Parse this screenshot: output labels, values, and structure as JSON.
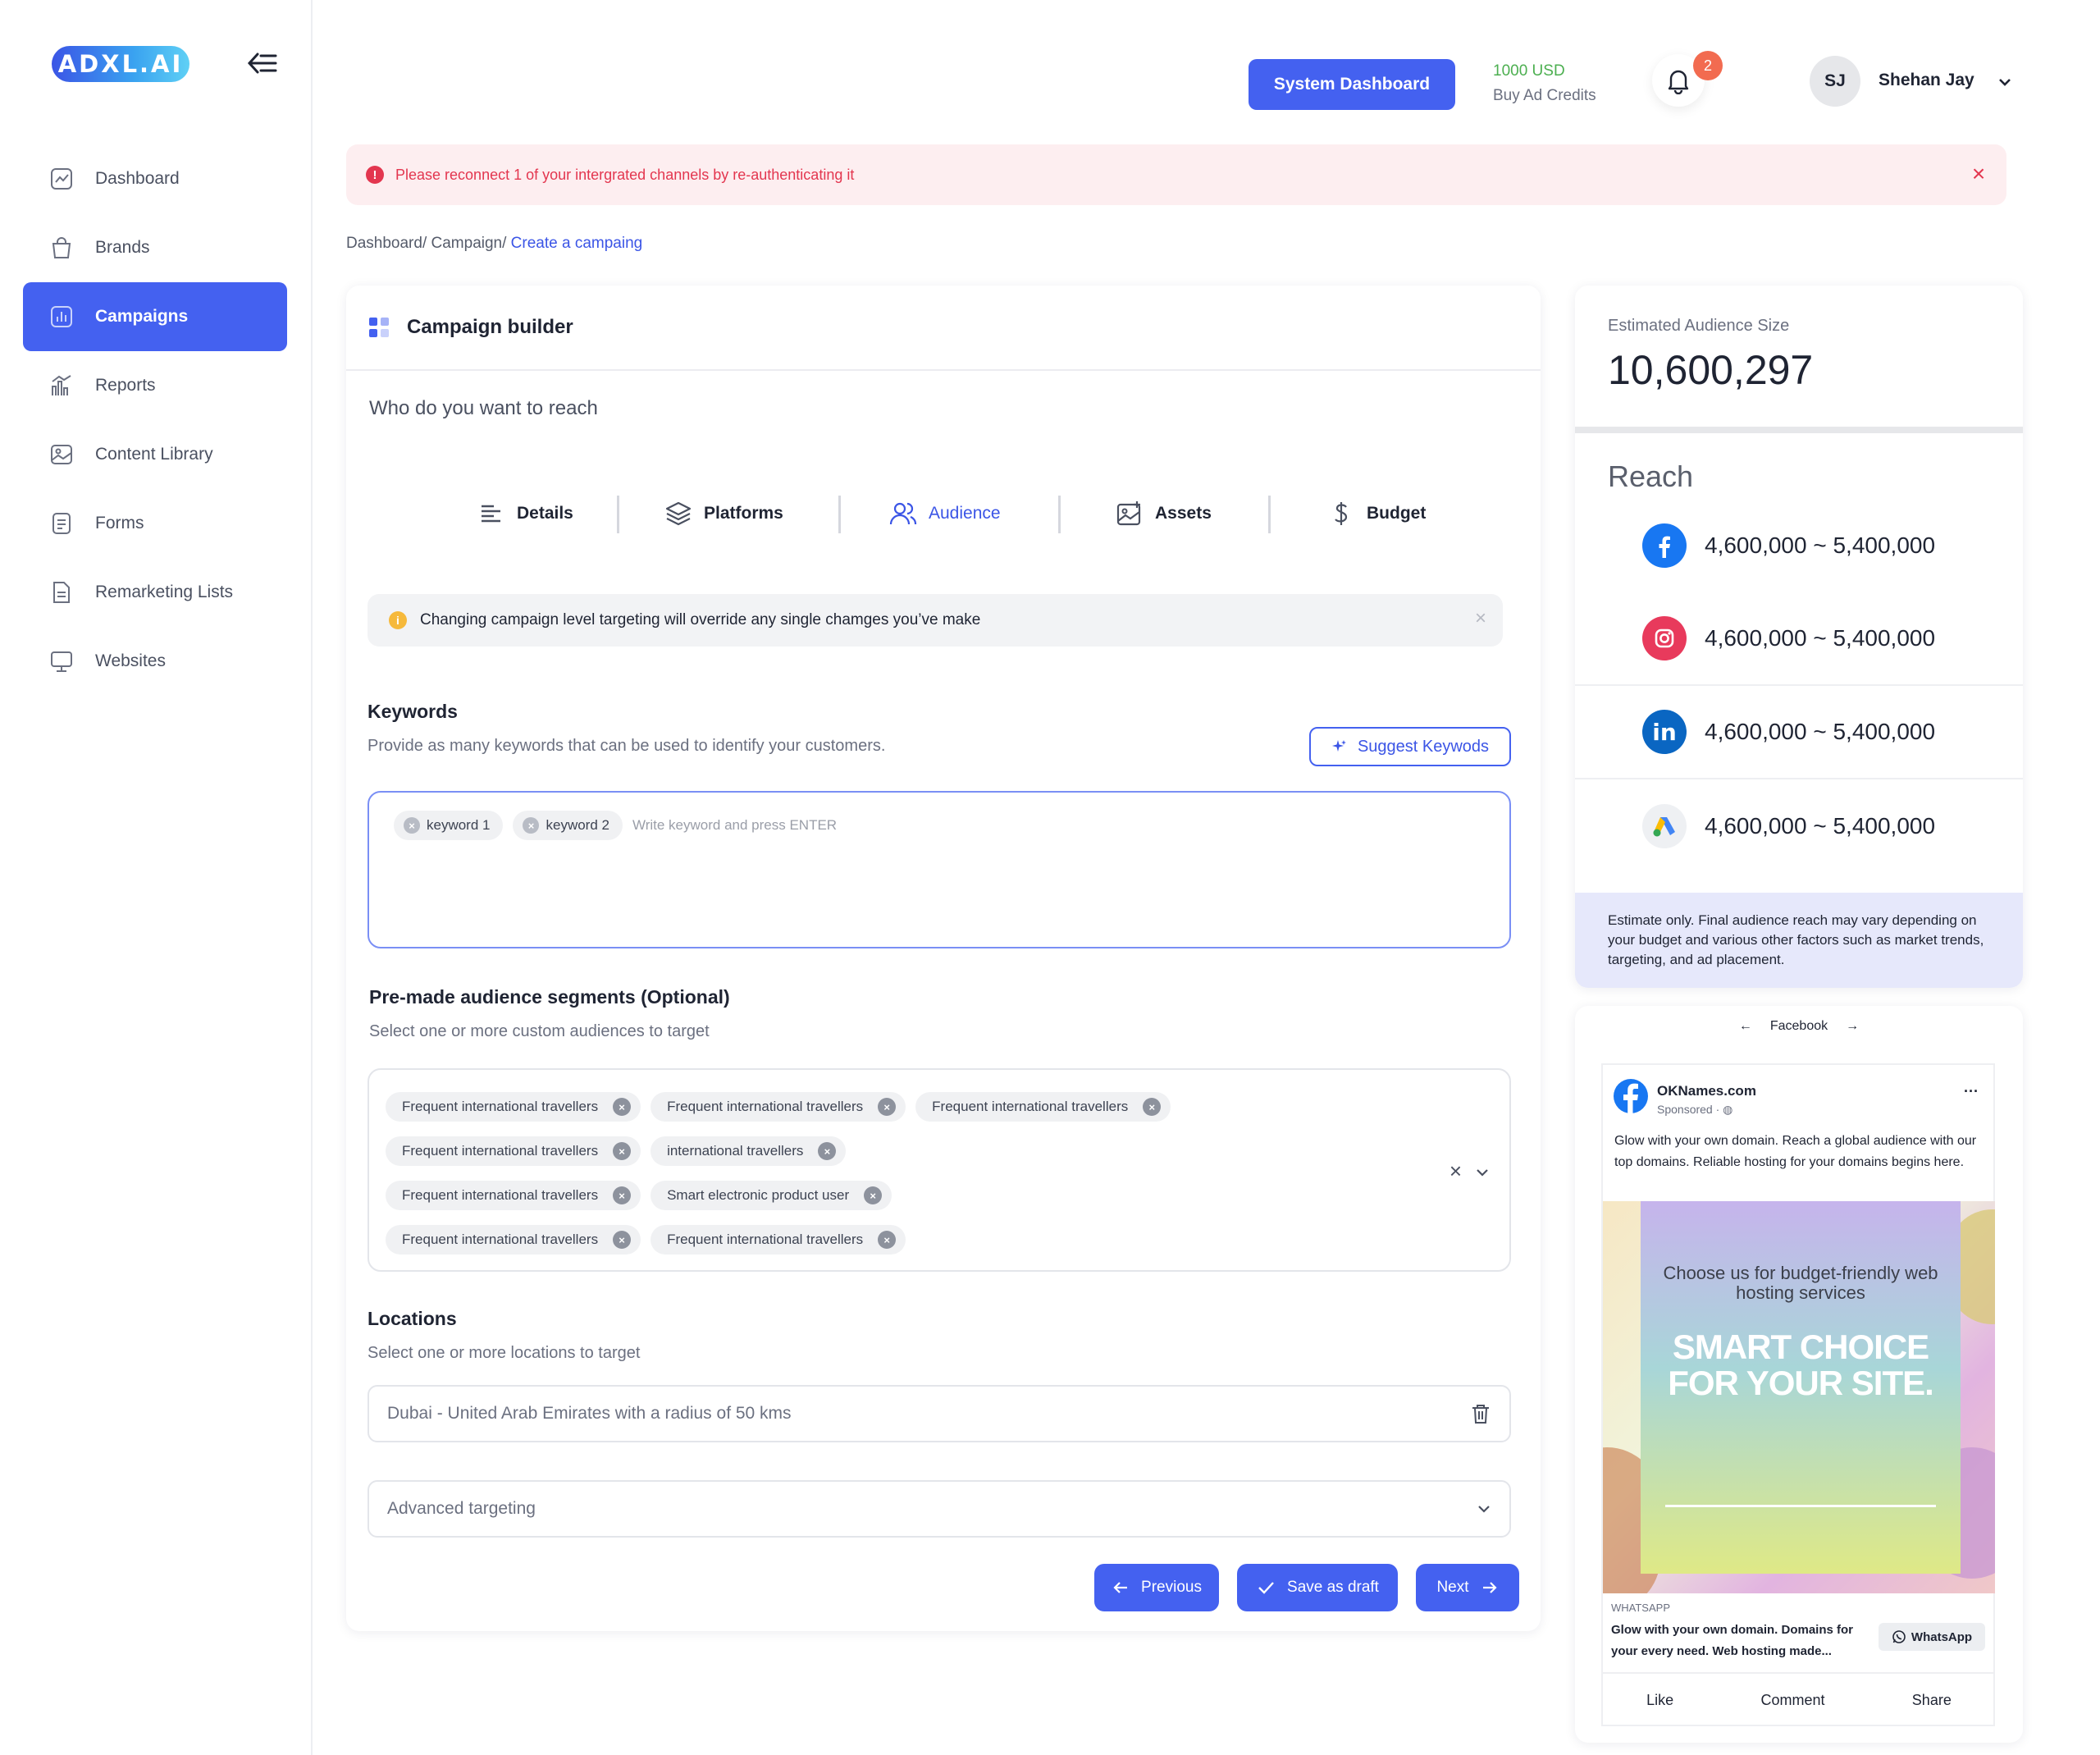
{
  "app": {
    "logo_text": "ADXL.AI"
  },
  "sidebar": {
    "items": [
      {
        "label": "Dashboard",
        "icon": "chart-line-icon"
      },
      {
        "label": "Brands",
        "icon": "shopping-bag-icon"
      },
      {
        "label": "Campaigns",
        "icon": "bar-chart-icon",
        "active": true
      },
      {
        "label": "Reports",
        "icon": "reports-icon"
      },
      {
        "label": "Content Library",
        "icon": "image-icon"
      },
      {
        "label": "Forms",
        "icon": "form-icon"
      },
      {
        "label": "Remarketing Lists",
        "icon": "list-doc-icon"
      },
      {
        "label": "Websites",
        "icon": "monitor-icon"
      }
    ]
  },
  "header": {
    "system_dashboard": "System Dashboard",
    "credits_amount": "1000 USD",
    "credits_action": "Buy Ad Credits",
    "notification_count": "2",
    "user_initials": "SJ",
    "user_name": "Shehan Jay"
  },
  "alert": {
    "text": "Please reconnect 1 of your intergrated channels by re-authenticating it"
  },
  "breadcrumb": {
    "part1": "Dashboard/",
    "part2": " Campaign/",
    "current": " Create a campaing"
  },
  "builder": {
    "title": "Campaign builder",
    "question": "Who do you want to reach",
    "steps": [
      {
        "label": "Details"
      },
      {
        "label": "Platforms"
      },
      {
        "label": "Audience",
        "active": true
      },
      {
        "label": "Assets"
      },
      {
        "label": "Budget"
      }
    ],
    "warning": "Changing campaign level targeting will override any single chamges you’ve make",
    "keywords": {
      "title": "Keywords",
      "subtitle": "Provide as many keywords that can be used to identify your customers.",
      "suggest_label": "Suggest Keywods",
      "chips": [
        "keyword 1",
        "keyword 2"
      ],
      "placeholder": "Write keyword and press ENTER"
    },
    "segments": {
      "title": "Pre-made audience segments (Optional)",
      "subtitle": "Select one or more custom audiences to target",
      "rows": [
        [
          "Frequent international travellers",
          "Frequent international travellers",
          "Frequent international travellers"
        ],
        [
          "Frequent international travellers",
          "international travellers"
        ],
        [
          "Frequent international travellers",
          "Smart electronic product user"
        ],
        [
          "Frequent international travellers",
          "Frequent international travellers"
        ]
      ]
    },
    "locations": {
      "title": "Locations",
      "subtitle": "Select one or more locations to target",
      "value": "Dubai - United Arab Emirates with a radius of 50 kms"
    },
    "advanced": "Advanced targeting",
    "buttons": {
      "previous": "Previous",
      "save": "Save as draft",
      "next": "Next"
    }
  },
  "audience": {
    "label": "Estimated Audience Size",
    "value": "10,600,297",
    "reach_title": "Reach",
    "rows": [
      {
        "platform": "facebook-icon",
        "range": "4,600,000 ~ 5,400,000"
      },
      {
        "platform": "instagram-icon",
        "range": "4,600,000 ~ 5,400,000"
      },
      {
        "platform": "linkedin-icon",
        "range": "4,600,000 ~ 5,400,000"
      },
      {
        "platform": "google-ads-icon",
        "range": "4,600,000 ~ 5,400,000"
      }
    ],
    "note": "Estimate only. Final audience reach may vary depending on your budget and various other factors such as market trends, targeting, and ad placement."
  },
  "preview": {
    "platform": "Facebook",
    "brand": "OKNames.com",
    "sponsored": "Sponsored · ",
    "text": "Glow with your own domain. Reach a global audience with our top domains. Reliable hosting for your domains begins here.",
    "image_sub": "Choose us for budget-friendly web hosting services",
    "image_big": "SMART CHOICE FOR YOUR SITE.",
    "source": "WHATSAPP",
    "headline": "Glow with your own domain. Domains for your every need. Web hosting made...",
    "cta": "WhatsApp",
    "actions": [
      "Like",
      "Comment",
      "Share"
    ]
  }
}
